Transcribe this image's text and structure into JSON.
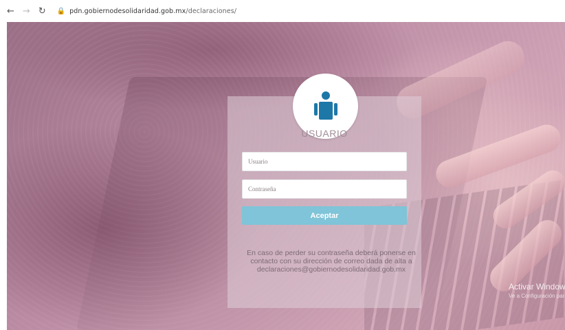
{
  "browser": {
    "back_icon": "arrow-left-icon",
    "forward_icon": "arrow-right-icon",
    "reload_icon": "reload-icon",
    "lock_icon": "lock-icon",
    "url_host": "pdn.gobiernodesolidaridad.gob.mx",
    "url_path": "/declaraciones/"
  },
  "login": {
    "avatar_icon": "user-icon",
    "title": "USUARIO",
    "username_placeholder": "Usuario",
    "password_placeholder": "Contraseña",
    "submit_label": "Aceptar",
    "accent_color": "#7fc4d8",
    "info_text": "En caso de perder su contraseña deberá ponerse en contacto con su dirección de correo dada de alta a declaraciones@gobiernodesolidaridad.gob.mx"
  },
  "watermark": {
    "title": "Activar Windows",
    "subtitle": "Ve a Configuración para activar Windows."
  }
}
